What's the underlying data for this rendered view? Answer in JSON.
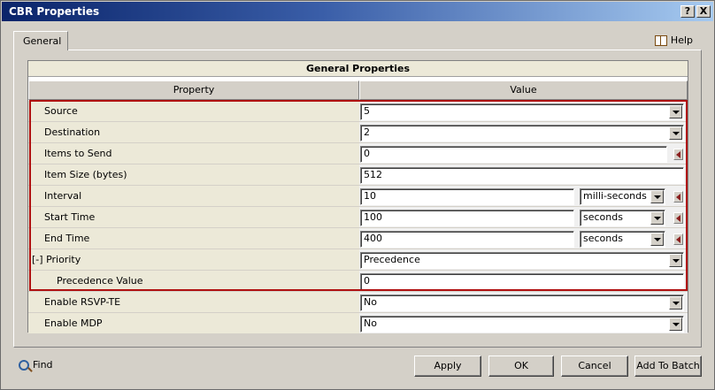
{
  "window": {
    "title": "CBR Properties",
    "help_button": "?",
    "close_button": "X"
  },
  "tabs": [
    {
      "label": "General"
    }
  ],
  "help": {
    "label": "Help"
  },
  "table": {
    "section_title": "General Properties",
    "columns": [
      "Property",
      "Value"
    ],
    "rows": [
      {
        "label": "Source",
        "value": "5",
        "type": "dropdown"
      },
      {
        "label": "Destination",
        "value": "2",
        "type": "dropdown"
      },
      {
        "label": "Items to Send",
        "value": "0",
        "type": "text-reset"
      },
      {
        "label": "Item Size (bytes)",
        "value": "512",
        "type": "text"
      },
      {
        "label": "Interval",
        "value": "10",
        "unit": "milli-seconds",
        "type": "text-unit"
      },
      {
        "label": "Start Time",
        "value": "100",
        "unit": "seconds",
        "type": "text-unit"
      },
      {
        "label": "End Time",
        "value": "400",
        "unit": "seconds",
        "type": "text-unit"
      },
      {
        "label": "Priority",
        "prefix": "[-]",
        "value": "Precedence",
        "type": "dropdown"
      },
      {
        "label": "Precedence Value",
        "value": "0",
        "type": "text-indent"
      },
      {
        "label": "Enable RSVP-TE",
        "value": "No",
        "type": "dropdown"
      },
      {
        "label": "Enable MDP",
        "value": "No",
        "type": "dropdown"
      }
    ]
  },
  "footer": {
    "find_label": "Find",
    "apply_label": "Apply",
    "ok_label": "OK",
    "cancel_label": "Cancel",
    "add_to_batch_label": "Add To Batch"
  },
  "colors": {
    "highlight_border": "#b01010",
    "title_bar_start": "#0a246a",
    "title_bar_end": "#a6caf0"
  }
}
